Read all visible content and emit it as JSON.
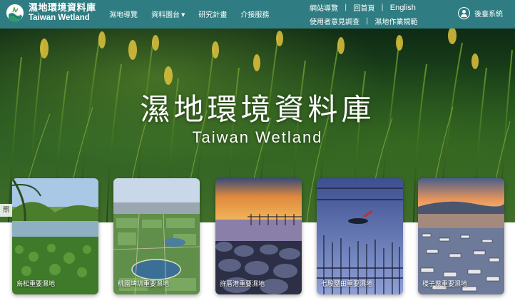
{
  "brand": {
    "name_zh": "濕地環境資料庫",
    "name_en": "Taiwan Wetland"
  },
  "nav": {
    "items": [
      {
        "label": "濕地導覽",
        "has_dropdown": false
      },
      {
        "label": "資料園台",
        "has_dropdown": true
      },
      {
        "label": "研究計畫",
        "has_dropdown": false
      },
      {
        "label": "介接服務",
        "has_dropdown": false
      }
    ]
  },
  "utility": {
    "sitemap": "網站導覽",
    "home": "回首頁",
    "english": "English",
    "survey": "使用者意見調查",
    "rules": "濕地作業規範"
  },
  "admin": {
    "label": "後臺系統",
    "icon": "user-circle-icon"
  },
  "hero": {
    "title": "濕地環境資料庫",
    "subtitle": "Taiwan Wetland",
    "side_tag": "照"
  },
  "cards": [
    {
      "label": "烏松重要濕地",
      "scene": "marsh"
    },
    {
      "label": "桃園埤圳重要濕地",
      "scene": "aerial"
    },
    {
      "label": "許厝港重要濕地",
      "scene": "sunset-rocks"
    },
    {
      "label": "七股鹽田重要濕地",
      "scene": "oyster"
    },
    {
      "label": "楼子蔡重要濕地",
      "scene": "boats"
    }
  ],
  "colors": {
    "header": "#2f7d82",
    "text_on_header": "#ffffff"
  }
}
